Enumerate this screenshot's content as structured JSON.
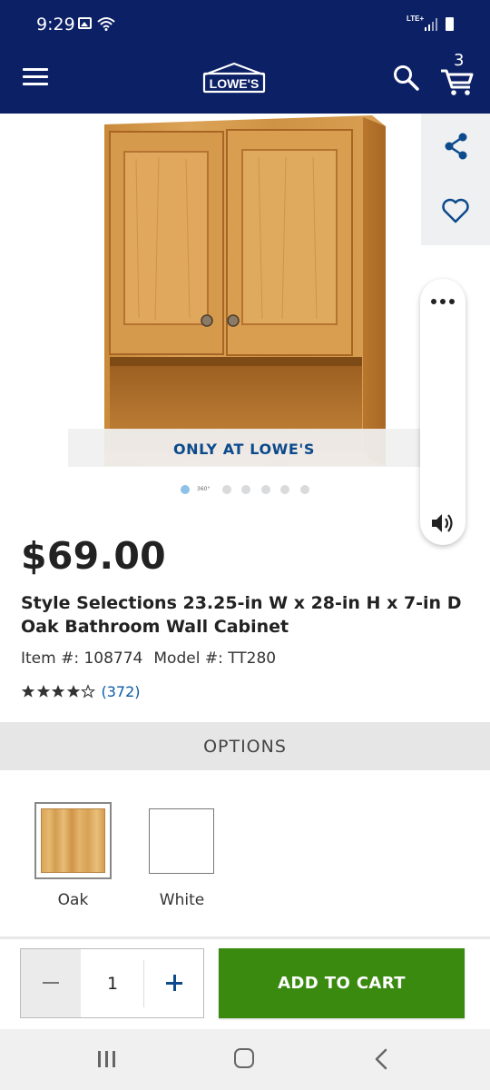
{
  "status_bar": {
    "time": "9:29",
    "network": "LTE+",
    "icons": [
      "image-icon",
      "wifi-icon",
      "signal-icon",
      "battery-icon"
    ]
  },
  "header": {
    "logo_text": "LOWE'S",
    "cart_count": "3",
    "background_color": "#0c2065",
    "icons": [
      "menu-icon",
      "search-icon",
      "cart-icon"
    ]
  },
  "product": {
    "banner": "ONLY AT LOWE'S",
    "carousel_360_label": "360°",
    "carousel_dot_count": 6,
    "carousel_active_index": 0,
    "price": "$69.00",
    "title": "Style Selections 23.25-in W x 28-in H x 7-in D Oak Bathroom Wall Cabinet",
    "item_number": "Item #: 108774",
    "model_number": "Model #: TT280",
    "rating_stars": 4.5,
    "review_count": "(372)",
    "side_icons": [
      "share-icon",
      "heart-icon",
      "more-icon",
      "speaker-icon"
    ]
  },
  "options": {
    "header": "OPTIONS",
    "swatches": [
      {
        "label": "Oak",
        "selected": true,
        "color": "#dba75e"
      },
      {
        "label": "White",
        "selected": false,
        "color": "#ffffff"
      }
    ]
  },
  "purchase": {
    "quantity": "1",
    "add_to_cart_label": "ADD TO CART",
    "button_color": "#3a8a10"
  },
  "nav": {
    "icons": [
      "recents-icon",
      "home-icon",
      "back-icon"
    ]
  }
}
